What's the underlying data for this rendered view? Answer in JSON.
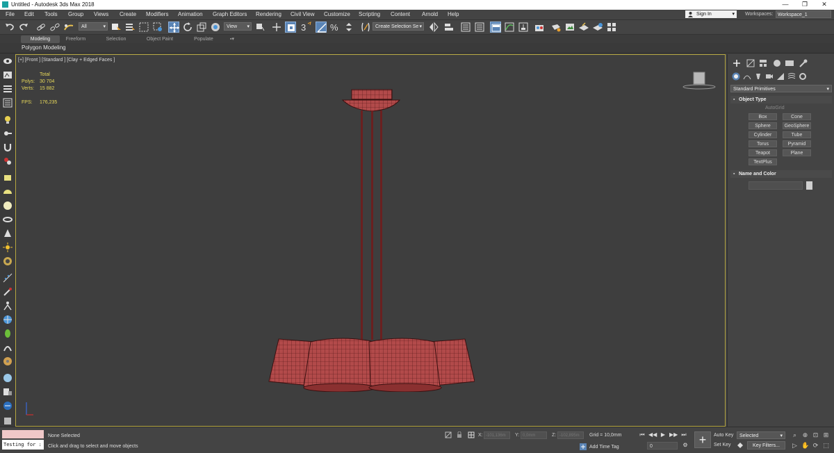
{
  "window": {
    "title": "Untitled - Autodesk 3ds Max 2018",
    "controls": [
      "—",
      "❐",
      "✕"
    ]
  },
  "menu": {
    "items": [
      "File",
      "Edit",
      "Tools",
      "Group",
      "Views",
      "Create",
      "Modifiers",
      "Animation",
      "Graph Editors",
      "Rendering",
      "Civil View",
      "Customize",
      "Scripting",
      "Content",
      "Arnold",
      "Help"
    ],
    "sign_in": "Sign In",
    "workspaces_label": "Workspaces:",
    "workspace_value": "Workspace_1"
  },
  "toolbar": {
    "selection_filter": "All",
    "reference_coord": "View",
    "named_selection": "Create Selection Se",
    "snap_label": "3",
    "percent_snap": "%"
  },
  "ribbon": {
    "tabs": [
      "Modeling",
      "Freeform",
      "Selection",
      "Object Paint",
      "Populate"
    ],
    "active_tab": "Modeling",
    "panel_label": "Polygon Modeling"
  },
  "viewport": {
    "label": "[+] [Front ] [Standard ] [Clay + Edged Faces ]",
    "stats": {
      "total_label": "Total",
      "polys_label": "Polys:",
      "polys_value": "30 704",
      "verts_label": "Verts:",
      "verts_value": "15 882",
      "fps_label": "FPS:",
      "fps_value": "176,235"
    },
    "model_color": "#b24a4a"
  },
  "command_panel": {
    "category": "Standard Primitives",
    "object_type_title": "Object Type",
    "autogrid": "AutoGrid",
    "buttons": [
      "Box",
      "Cone",
      "Sphere",
      "GeoSphere",
      "Cylinder",
      "Tube",
      "Torus",
      "Pyramid",
      "Teapot",
      "Plane",
      "TextPlus"
    ],
    "name_color_title": "Name and Color"
  },
  "status": {
    "selection": "None Selected",
    "prompt": "Click and drag to select and move objects",
    "script_input": "Testing for :",
    "x_label": "X:",
    "x_value": "-101,136m",
    "y_label": "Y:",
    "y_value": "0,0mm",
    "z_label": "Z:",
    "z_value": "-102,895m",
    "grid": "Grid = 10,0mm",
    "add_time_tag": "Add Time Tag",
    "frame": "0",
    "auto_key": "Auto Key",
    "set_key": "Set Key",
    "selected_dropdown": "Selected",
    "key_filters": "Key Filters..."
  },
  "colors": {
    "accent": "#5a84b5",
    "viewport_border": "#b5a640",
    "stats_text": "#e8d95a"
  }
}
